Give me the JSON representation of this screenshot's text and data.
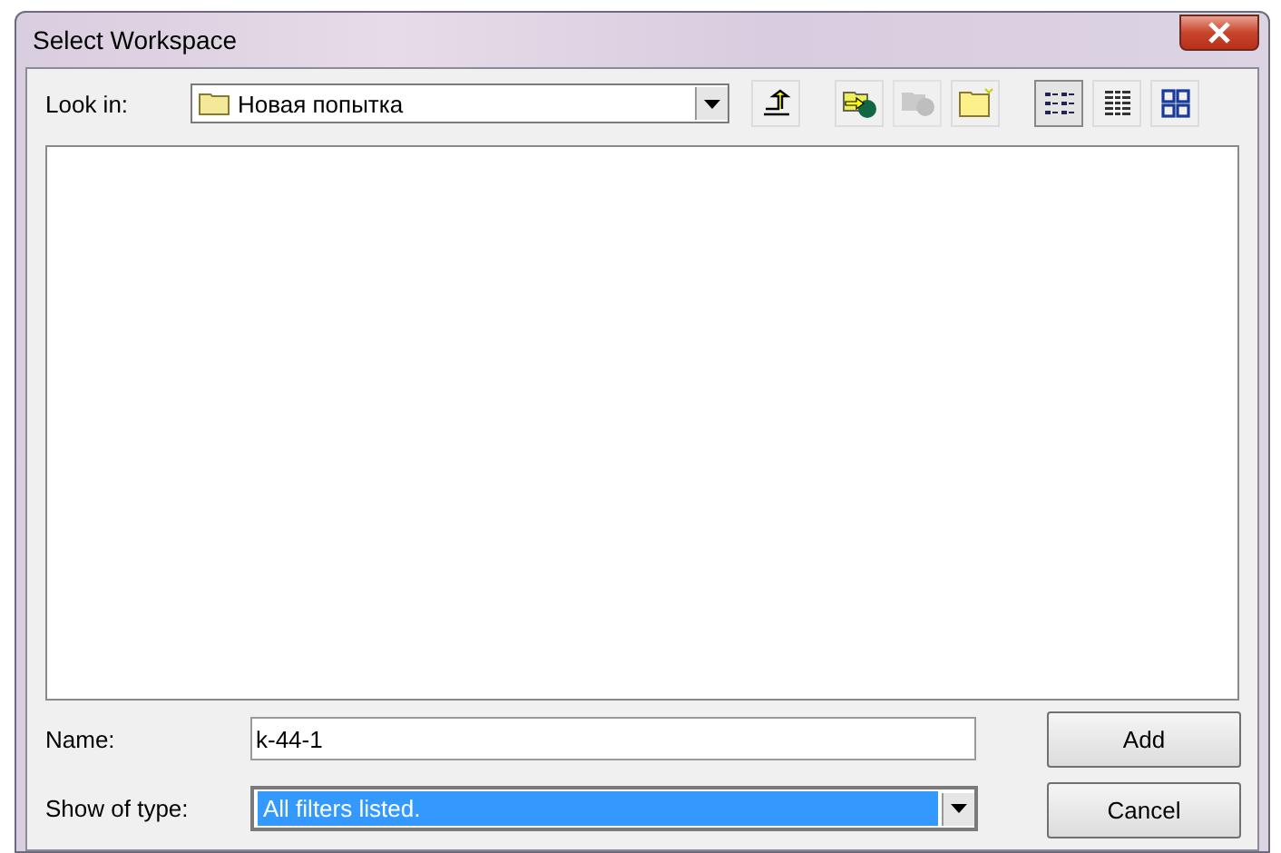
{
  "window": {
    "title": "Select Workspace"
  },
  "look_in": {
    "label": "Look in:",
    "value": "Новая попытка"
  },
  "toolbar": [
    {
      "kind": "up",
      "disabled": false,
      "selected": false
    },
    {
      "kind": "connect",
      "disabled": false,
      "selected": false
    },
    {
      "kind": "disconnect",
      "disabled": true,
      "selected": false
    },
    {
      "kind": "newfolder",
      "disabled": false,
      "selected": false
    },
    {
      "kind": "list",
      "disabled": false,
      "selected": true
    },
    {
      "kind": "details",
      "disabled": false,
      "selected": false
    },
    {
      "kind": "thumbs",
      "disabled": false,
      "selected": false
    }
  ],
  "name": {
    "label": "Name:",
    "value": "k-44-1"
  },
  "show_of_type": {
    "label": "Show of type:",
    "value": "All filters listed."
  },
  "buttons": [
    "Add",
    "Cancel"
  ]
}
